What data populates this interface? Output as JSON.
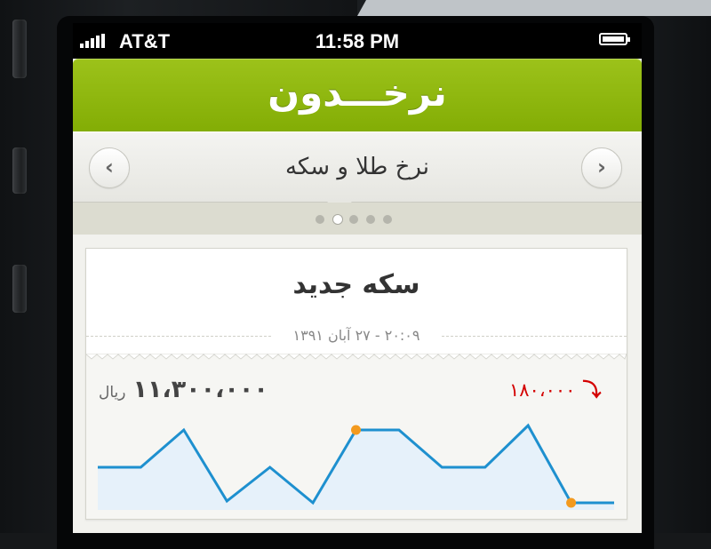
{
  "status_bar": {
    "carrier": "AT&T",
    "time": "11:58 PM"
  },
  "app": {
    "title": "نرخـــدون"
  },
  "category_nav": {
    "title": "نرخ طلا و سکه",
    "prev_icon": "chevron-left-icon",
    "next_icon": "chevron-right-icon",
    "page_count": 5,
    "active_page": 2
  },
  "item": {
    "title": "سکه جدید",
    "date": "۲۰:۰۹ - ۲۷ آبان ۱۳۹۱",
    "price": "۱۱،۳۰۰،۰۰۰",
    "currency": "ریال",
    "change": "۱۸۰،۰۰۰",
    "change_direction": "down",
    "change_color": "#d40000"
  },
  "colors": {
    "header_green": "#8db80e",
    "line_blue": "#1e90cf",
    "area_fill": "#e6f1fa",
    "marker_orange": "#f39a1e"
  },
  "chart_data": {
    "type": "area",
    "x": [
      1,
      2,
      3,
      4,
      5,
      6,
      7,
      8,
      9,
      10,
      11,
      12,
      13
    ],
    "values": [
      0.48,
      0.48,
      0.9,
      0.1,
      0.48,
      0.08,
      0.9,
      0.9,
      0.48,
      0.48,
      0.95,
      0.08,
      0.08
    ],
    "highlight_points": [
      6,
      11
    ],
    "title": "",
    "xlabel": "",
    "ylabel": "",
    "grid": false
  }
}
